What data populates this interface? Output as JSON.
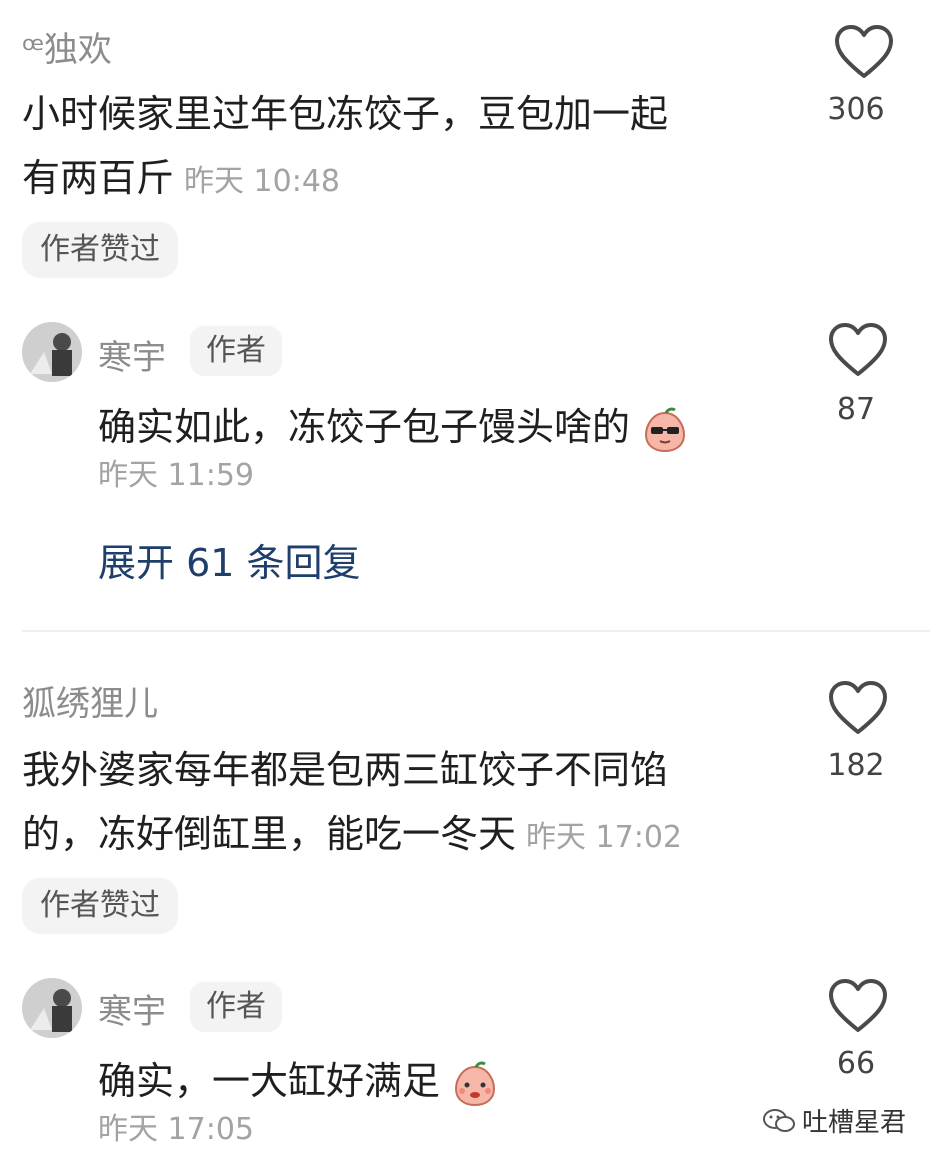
{
  "comments": [
    {
      "username": "ꟹ独欢",
      "text": "小时候家里过年包冻饺子，豆包加一起有两百斤",
      "text_line1": "小时候家里过年包冻饺子，豆包加一起",
      "text_line2": "有两百斤",
      "time": "昨天 10:48",
      "badge": "作者赞过",
      "likes": "306",
      "reply": {
        "username": "寒宇",
        "tag": "作者",
        "text": "确实如此，冻饺子包子馒头啥的",
        "emoji": "sunglasses-peach-emoji",
        "time": "昨天 11:59",
        "likes": "87"
      },
      "expand_label": "展开 61 条回复"
    },
    {
      "username": "狐绣狸儿",
      "text_line1": "我外婆家每年都是包两三缸饺子不同馅",
      "text_line2": "的，冻好倒缸里，能吃一冬天",
      "time": "昨天 17:02",
      "badge": "作者赞过",
      "likes": "182",
      "reply": {
        "username": "寒宇",
        "tag": "作者",
        "text": "确实，一大缸好满足",
        "emoji": "shy-peach-emoji",
        "time": "昨天 17:05",
        "likes": "66"
      }
    }
  ],
  "watermark": "吐槽星君",
  "colors": {
    "link": "#1e3f6b",
    "muted": "#8c8c8c",
    "pill_bg": "#f3f3f3"
  }
}
